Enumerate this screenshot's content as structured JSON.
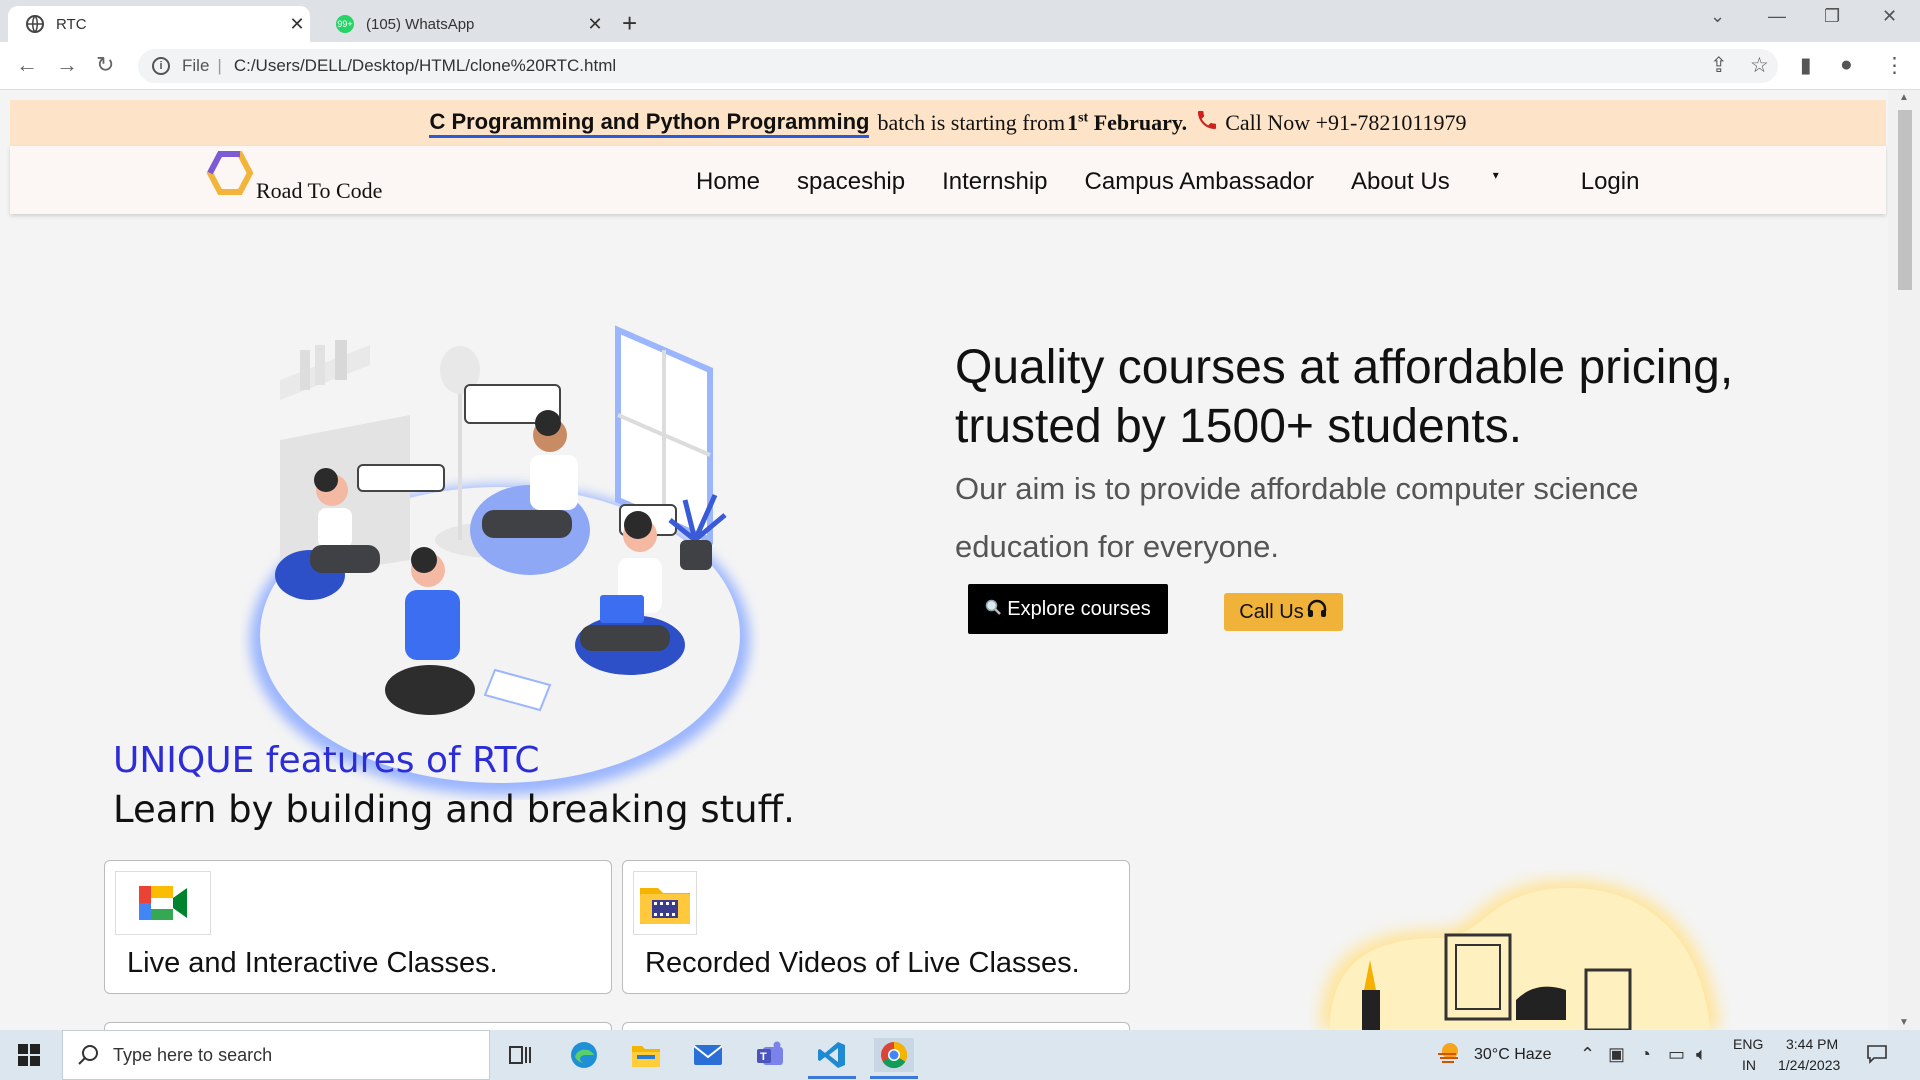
{
  "browser": {
    "tabs": [
      {
        "title": "RTC",
        "active": true
      },
      {
        "title": "(105) WhatsApp",
        "active": false
      }
    ],
    "url_scheme_label": "File",
    "url": "C:/Users/DELL/Desktop/HTML/clone%20RTC.html"
  },
  "announcement": {
    "course": "C Programming and Python Programming",
    "text": "batch is starting from",
    "date_num": "1",
    "date_sup": "st",
    "date_month": "February.",
    "call_text": "Call Now +91-7821011979"
  },
  "navbar": {
    "brand": "Road To Code",
    "links": [
      "Home",
      "spaceship",
      "Internship",
      "Campus Ambassador",
      "About Us"
    ],
    "login": "Login"
  },
  "hero": {
    "title": "Quality courses at affordable pricing, trusted by 1500+ students.",
    "subtitle": "Our aim is to provide affordable computer science education for everyone.",
    "explore_button": "Explore courses",
    "call_button": "Call Us"
  },
  "features": {
    "title": "UNIQUE features of RTC",
    "subtitle": "Learn by building and breaking stuff.",
    "cards": [
      {
        "label": "Live and Interactive Classes.",
        "icon": "video-meet-icon"
      },
      {
        "label": "Recorded Videos of Live Classes.",
        "icon": "film-folder-icon"
      }
    ]
  },
  "taskbar": {
    "search_placeholder": "Type here to search",
    "weather": "30°C  Haze",
    "lang": "ENG",
    "region": "IN",
    "time": "3:44 PM",
    "date": "1/24/2023"
  },
  "colors": {
    "announcement_bg": "#fde3c7",
    "feature_title": "#2d2dd8",
    "call_button": "#f0b238",
    "explore_button": "#000000"
  }
}
